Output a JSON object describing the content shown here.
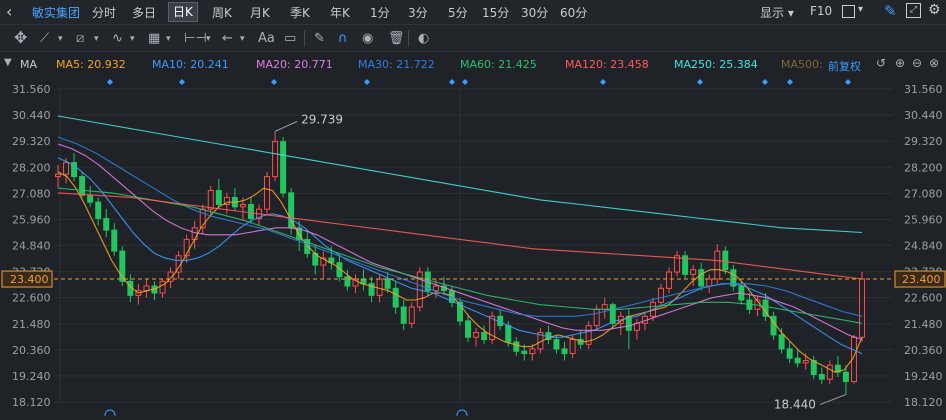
{
  "header": {
    "stock_name": "敏实集团",
    "periods": [
      "分时",
      "多日",
      "日K",
      "周K",
      "月K",
      "季K",
      "年K",
      "1分",
      "3分",
      "5分",
      "15分",
      "30分",
      "60分"
    ],
    "active_period": "日K",
    "display_label": "显示",
    "f10_label": "F10"
  },
  "toolbar": {
    "text_tool": "Aa"
  },
  "ma_bar": {
    "label": "MA",
    "items": [
      {
        "text": "MA5: 20.932",
        "color": "#f5a623"
      },
      {
        "text": "MA10: 20.241",
        "color": "#3d9bff"
      },
      {
        "text": "MA20: 20.771",
        "color": "#e07de0"
      },
      {
        "text": "MA30: 21.722",
        "color": "#2f7fe0"
      },
      {
        "text": "MA60: 21.425",
        "color": "#2fbf71"
      },
      {
        "text": "MA120: 23.458",
        "color": "#ff5a5a"
      },
      {
        "text": "MA250: 25.384",
        "color": "#3fe0e0"
      },
      {
        "text": "MA500:",
        "color": "#7a6a3a"
      }
    ],
    "adjust_label": "前复权"
  },
  "chart_data": {
    "type": "candlestick",
    "y_ticks": [
      "31.560",
      "30.440",
      "29.320",
      "28.200",
      "27.080",
      "25.960",
      "24.840",
      "23.720",
      "22.600",
      "21.480",
      "20.360",
      "19.240",
      "18.120"
    ],
    "ylim": [
      18.12,
      31.56
    ],
    "current_price": "23.400",
    "high_label": "29.739",
    "low_label": "18.440",
    "candles": [
      [
        27.8,
        28.3,
        27.3,
        27.9
      ],
      [
        27.9,
        28.6,
        27.5,
        28.4
      ],
      [
        28.4,
        28.8,
        27.6,
        27.8
      ],
      [
        27.8,
        28.0,
        26.9,
        27.0
      ],
      [
        27.0,
        27.4,
        26.5,
        26.7
      ],
      [
        26.7,
        26.9,
        25.7,
        26.0
      ],
      [
        26.0,
        26.4,
        25.2,
        25.5
      ],
      [
        25.5,
        25.8,
        24.4,
        24.6
      ],
      [
        24.6,
        24.8,
        23.1,
        23.3
      ],
      [
        23.3,
        23.6,
        22.4,
        22.7
      ],
      [
        22.7,
        23.2,
        22.3,
        22.9
      ],
      [
        22.9,
        23.4,
        22.6,
        23.1
      ],
      [
        23.1,
        23.3,
        22.5,
        22.8
      ],
      [
        22.8,
        23.4,
        22.6,
        23.3
      ],
      [
        23.3,
        23.9,
        23.0,
        23.7
      ],
      [
        23.7,
        24.6,
        23.4,
        24.4
      ],
      [
        24.4,
        25.3,
        24.1,
        25.1
      ],
      [
        25.1,
        25.9,
        24.7,
        25.6
      ],
      [
        25.6,
        26.6,
        25.3,
        26.4
      ],
      [
        26.4,
        27.4,
        26.1,
        27.2
      ],
      [
        27.2,
        27.7,
        26.4,
        26.6
      ],
      [
        26.6,
        27.1,
        26.2,
        26.9
      ],
      [
        26.9,
        27.3,
        26.3,
        26.5
      ],
      [
        26.5,
        26.9,
        25.9,
        26.6
      ],
      [
        26.6,
        26.9,
        25.8,
        26.0
      ],
      [
        26.0,
        26.6,
        25.7,
        26.4
      ],
      [
        26.4,
        28.0,
        26.2,
        27.8
      ],
      [
        27.8,
        29.74,
        27.6,
        29.3
      ],
      [
        29.3,
        29.5,
        26.9,
        27.1
      ],
      [
        27.1,
        27.3,
        25.3,
        25.6
      ],
      [
        25.6,
        25.9,
        24.6,
        25.1
      ],
      [
        25.1,
        25.5,
        24.3,
        24.5
      ],
      [
        24.5,
        24.9,
        23.6,
        24.0
      ],
      [
        24.0,
        24.6,
        23.4,
        24.3
      ],
      [
        24.3,
        24.8,
        23.8,
        24.1
      ],
      [
        24.1,
        24.4,
        23.3,
        23.5
      ],
      [
        23.5,
        23.8,
        22.9,
        23.1
      ],
      [
        23.1,
        23.6,
        22.8,
        23.4
      ],
      [
        23.4,
        23.8,
        22.9,
        23.2
      ],
      [
        23.2,
        23.5,
        22.4,
        22.7
      ],
      [
        22.7,
        23.6,
        22.4,
        23.4
      ],
      [
        23.4,
        23.7,
        22.8,
        23.0
      ],
      [
        23.0,
        23.3,
        21.9,
        22.2
      ],
      [
        22.2,
        22.5,
        21.2,
        21.5
      ],
      [
        21.5,
        22.4,
        21.3,
        22.2
      ],
      [
        22.2,
        23.9,
        22.0,
        23.7
      ],
      [
        23.7,
        23.9,
        22.7,
        22.9
      ],
      [
        22.9,
        23.4,
        22.6,
        23.1
      ],
      [
        23.1,
        23.5,
        22.7,
        22.9
      ],
      [
        22.9,
        23.1,
        22.2,
        22.4
      ],
      [
        22.4,
        22.6,
        21.4,
        21.6
      ],
      [
        21.6,
        21.9,
        20.7,
        20.9
      ],
      [
        20.9,
        21.3,
        20.5,
        21.1
      ],
      [
        21.1,
        21.4,
        20.6,
        20.8
      ],
      [
        20.8,
        22.0,
        20.6,
        21.8
      ],
      [
        21.8,
        22.1,
        21.2,
        21.4
      ],
      [
        21.4,
        21.6,
        20.5,
        20.7
      ],
      [
        20.7,
        20.9,
        20.1,
        20.3
      ],
      [
        20.3,
        20.6,
        19.9,
        20.2
      ],
      [
        20.2,
        20.6,
        19.9,
        20.4
      ],
      [
        20.4,
        21.3,
        20.2,
        21.1
      ],
      [
        21.1,
        21.4,
        20.6,
        20.8
      ],
      [
        20.8,
        21.0,
        20.2,
        20.4
      ],
      [
        20.4,
        20.7,
        19.9,
        20.2
      ],
      [
        20.2,
        21.0,
        20.0,
        20.8
      ],
      [
        20.8,
        21.2,
        20.4,
        20.6
      ],
      [
        20.6,
        21.6,
        20.4,
        21.4
      ],
      [
        21.4,
        22.3,
        21.2,
        22.1
      ],
      [
        22.1,
        22.6,
        21.7,
        22.3
      ],
      [
        22.3,
        22.4,
        21.3,
        21.5
      ],
      [
        21.5,
        22.0,
        21.0,
        21.8
      ],
      [
        21.8,
        22.1,
        20.4,
        21.2
      ],
      [
        21.2,
        21.7,
        20.8,
        21.5
      ],
      [
        21.5,
        22.0,
        21.2,
        21.8
      ],
      [
        21.8,
        22.6,
        21.6,
        22.4
      ],
      [
        22.4,
        23.2,
        22.2,
        23.0
      ],
      [
        23.0,
        23.9,
        22.8,
        23.7
      ],
      [
        23.7,
        24.6,
        23.5,
        24.4
      ],
      [
        24.4,
        24.6,
        23.4,
        23.6
      ],
      [
        23.6,
        24.0,
        23.1,
        23.8
      ],
      [
        23.8,
        24.1,
        22.9,
        23.1
      ],
      [
        23.1,
        23.6,
        22.8,
        23.4
      ],
      [
        23.4,
        24.9,
        23.2,
        24.6
      ],
      [
        24.6,
        24.8,
        23.6,
        23.8
      ],
      [
        23.8,
        24.0,
        22.9,
        23.1
      ],
      [
        23.1,
        23.3,
        22.3,
        22.5
      ],
      [
        22.5,
        22.8,
        21.9,
        22.1
      ],
      [
        22.1,
        22.7,
        21.8,
        22.5
      ],
      [
        22.5,
        22.8,
        21.6,
        21.8
      ],
      [
        21.8,
        22.0,
        20.8,
        21.0
      ],
      [
        21.0,
        21.3,
        20.2,
        20.4
      ],
      [
        20.4,
        20.7,
        19.8,
        20.0
      ],
      [
        20.0,
        20.4,
        19.6,
        19.8
      ],
      [
        19.8,
        20.2,
        19.5,
        19.9
      ],
      [
        19.9,
        20.1,
        19.1,
        19.3
      ],
      [
        19.3,
        19.6,
        18.9,
        19.1
      ],
      [
        19.1,
        19.9,
        18.9,
        19.7
      ],
      [
        19.7,
        20.1,
        19.2,
        19.4
      ],
      [
        19.4,
        19.7,
        18.44,
        19.0
      ],
      [
        19.0,
        21.0,
        18.9,
        20.9
      ],
      [
        20.9,
        23.7,
        20.7,
        23.4
      ]
    ],
    "ma_lines": [
      {
        "name": "MA5",
        "color": "#f5a623",
        "values": [
          28.0,
          27.8,
          27.3,
          26.6,
          25.8,
          25.0,
          24.2,
          23.6,
          23.1,
          22.8,
          22.9,
          23.0,
          23.2,
          23.6,
          24.2,
          24.9,
          25.6,
          26.1,
          26.5,
          26.7,
          26.7,
          26.8,
          27.0,
          27.3,
          27.2,
          26.7,
          26.0,
          25.3,
          24.8,
          24.4,
          24.2,
          24.0,
          23.7,
          23.4,
          23.2,
          23.1,
          23.0,
          22.9,
          22.7,
          22.5,
          22.5,
          22.6,
          22.8,
          22.8,
          22.7,
          22.3,
          21.8,
          21.4,
          21.1,
          20.9,
          20.7,
          20.6,
          20.5,
          20.5,
          20.7,
          20.9,
          21.0,
          20.9,
          20.8,
          20.7,
          20.8,
          21.0,
          21.3,
          21.6,
          21.8,
          21.9,
          22.0,
          22.1,
          22.2,
          22.5,
          22.9,
          23.3,
          23.6,
          23.8,
          23.8,
          23.7,
          23.5,
          23.1,
          22.6,
          22.1,
          21.6,
          21.1,
          20.7,
          20.3,
          20.0,
          19.8,
          19.6,
          19.4,
          19.5,
          20.0,
          20.9
        ]
      },
      {
        "name": "MA10",
        "color": "#3d9bff",
        "values": [
          28.6,
          28.4,
          28.1,
          27.7,
          27.2,
          26.6,
          26.0,
          25.4,
          24.9,
          24.5,
          24.3,
          24.2,
          24.2,
          24.3,
          24.5,
          24.8,
          25.2,
          25.6,
          25.9,
          26.1,
          26.2,
          26.1,
          25.9,
          25.6,
          25.2,
          24.8,
          24.5,
          24.2,
          24.0,
          23.8,
          23.6,
          23.4,
          23.2,
          23.0,
          22.9,
          22.8,
          22.6,
          22.4,
          22.2,
          22.0,
          21.8,
          21.6,
          21.4,
          21.2,
          21.1,
          21.0,
          20.9,
          20.9,
          21.0,
          21.1,
          21.2,
          21.4,
          21.6,
          21.7,
          21.8,
          22.0,
          22.2,
          22.4,
          22.6,
          22.8,
          23.0,
          23.1,
          23.2,
          23.2,
          23.1,
          22.9,
          22.7,
          22.4,
          22.1,
          21.8,
          21.5,
          21.2,
          20.9,
          20.6,
          20.4,
          20.2
        ]
      },
      {
        "name": "MA20",
        "color": "#e07de0",
        "values": [
          29.2,
          29.0,
          28.7,
          28.3,
          27.8,
          27.3,
          26.8,
          26.3,
          25.9,
          25.6,
          25.4,
          25.3,
          25.3,
          25.3,
          25.4,
          25.5,
          25.6,
          25.6,
          25.5,
          25.3,
          25.0,
          24.7,
          24.4,
          24.1,
          23.9,
          23.7,
          23.5,
          23.3,
          23.1,
          22.9,
          22.7,
          22.5,
          22.3,
          22.1,
          21.9,
          21.7,
          21.5,
          21.3,
          21.2,
          21.2,
          21.2,
          21.3,
          21.4,
          21.6,
          21.8,
          22.0,
          22.2,
          22.4,
          22.6,
          22.7,
          22.8,
          22.7,
          22.6,
          22.4,
          22.2,
          21.9,
          21.6,
          21.3,
          21.0,
          20.8
        ]
      },
      {
        "name": "MA30",
        "color": "#2f7fe0",
        "values": [
          29.5,
          29.2,
          28.8,
          28.3,
          27.8,
          27.3,
          26.8,
          26.4,
          26.1,
          25.9,
          25.7,
          25.5,
          25.2,
          24.9,
          24.6,
          24.3,
          24.0,
          23.7,
          23.4,
          23.1,
          22.8,
          22.5,
          22.3,
          22.1,
          21.9,
          21.8,
          21.8,
          21.8,
          21.9,
          22.1,
          22.3,
          22.5,
          22.7,
          22.9,
          23.1,
          23.2,
          23.2,
          23.1,
          22.9,
          22.6,
          22.3,
          22.0,
          21.8
        ]
      },
      {
        "name": "MA60",
        "color": "#2fbf71",
        "values": [
          27.3,
          27.2,
          27.1,
          26.9,
          26.7,
          26.5,
          26.2,
          25.9,
          25.5,
          25.1,
          24.7,
          24.3,
          23.9,
          23.6,
          23.3,
          23.0,
          22.7,
          22.5,
          22.3,
          22.2,
          22.1,
          22.1,
          22.2,
          22.3,
          22.4,
          22.4,
          22.3,
          22.1,
          21.9,
          21.7,
          21.5
        ]
      },
      {
        "name": "MA120",
        "color": "#ff5a5a",
        "values": [
          27.1,
          27.0,
          26.9,
          26.7,
          26.5,
          26.3,
          26.1,
          25.9,
          25.7,
          25.5,
          25.3,
          25.1,
          24.9,
          24.7,
          24.6,
          24.5,
          24.4,
          24.3,
          24.2,
          24.0,
          23.8,
          23.6,
          23.4
        ]
      },
      {
        "name": "MA250",
        "color": "#3fe0e0",
        "values": [
          30.4,
          30.1,
          29.8,
          29.5,
          29.2,
          28.9,
          28.6,
          28.3,
          28.0,
          27.7,
          27.4,
          27.1,
          26.8,
          26.6,
          26.4,
          26.2,
          26.0,
          25.8,
          25.6,
          25.5,
          25.4
        ]
      }
    ]
  }
}
